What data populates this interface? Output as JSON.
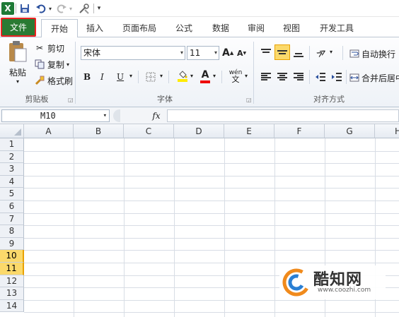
{
  "qat": {
    "app_icon": "excel-icon",
    "items": [
      "save-icon",
      "undo-icon",
      "undo-dropdown-icon",
      "redo-icon",
      "redo-dropdown-icon",
      "tools-icon",
      "customize-qat-icon"
    ]
  },
  "tabs": [
    "文件",
    "开始",
    "插入",
    "页面布局",
    "公式",
    "数据",
    "审阅",
    "视图",
    "开发工具"
  ],
  "clipboard": {
    "paste": "粘贴",
    "cut": "剪切",
    "copy": "复制",
    "format_painter": "格式刷",
    "group": "剪贴板"
  },
  "font": {
    "name": "宋体",
    "size": "11",
    "bold": "B",
    "italic": "I",
    "underline": "U",
    "font_color_letter": "A",
    "phonetic": "wén",
    "grow": "A",
    "shrink": "A",
    "group": "字体"
  },
  "alignment": {
    "wrap_text": "自动换行",
    "merge_center": "合并后居中",
    "group": "对齐方式"
  },
  "formula_bar": {
    "name_box": "M10",
    "fx": "fx",
    "content": ""
  },
  "grid": {
    "columns": [
      "A",
      "B",
      "C",
      "D",
      "E",
      "F",
      "G",
      "H"
    ],
    "rows": [
      "1",
      "2",
      "3",
      "4",
      "5",
      "6",
      "7",
      "8",
      "9",
      "10",
      "11",
      "12",
      "13",
      "14"
    ],
    "selected_rows": [
      "10",
      "11"
    ]
  },
  "watermark": {
    "logo": "c-logo",
    "title": "酷知网",
    "url": "www.coozhi.com"
  },
  "colors": {
    "file_tab": "#2a7a33",
    "selected_row": "#fbd96b",
    "highlight_orange": "#e9a100"
  }
}
